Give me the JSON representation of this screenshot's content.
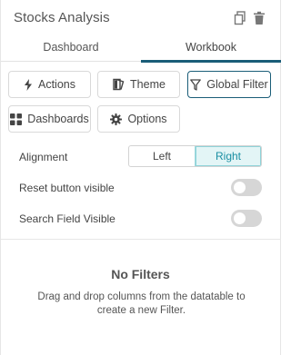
{
  "header": {
    "title": "Stocks Analysis",
    "icons": [
      "copy-icon",
      "trash-icon"
    ]
  },
  "tabs": [
    {
      "label": "Dashboard",
      "active": false
    },
    {
      "label": "Workbook",
      "active": true
    }
  ],
  "buttons": {
    "actions": "Actions",
    "theme": "Theme",
    "global_filter": "Global Filter",
    "dashboards": "Dashboards",
    "options": "Options"
  },
  "settings": {
    "alignment_label": "Alignment",
    "alignment_options": [
      "Left",
      "Right"
    ],
    "alignment_selected": "Right",
    "reset_label": "Reset button visible",
    "reset_on": false,
    "search_label": "Search Field Visible",
    "search_on": false
  },
  "empty": {
    "title": "No Filters",
    "description": "Drag and drop columns from the datatable to create a new Filter."
  },
  "colors": {
    "accent": "#1a5d78",
    "selected_bg": "#e3f5f6",
    "selected_text": "#1a8fa3",
    "toggle_off": "#d6d6d6"
  }
}
